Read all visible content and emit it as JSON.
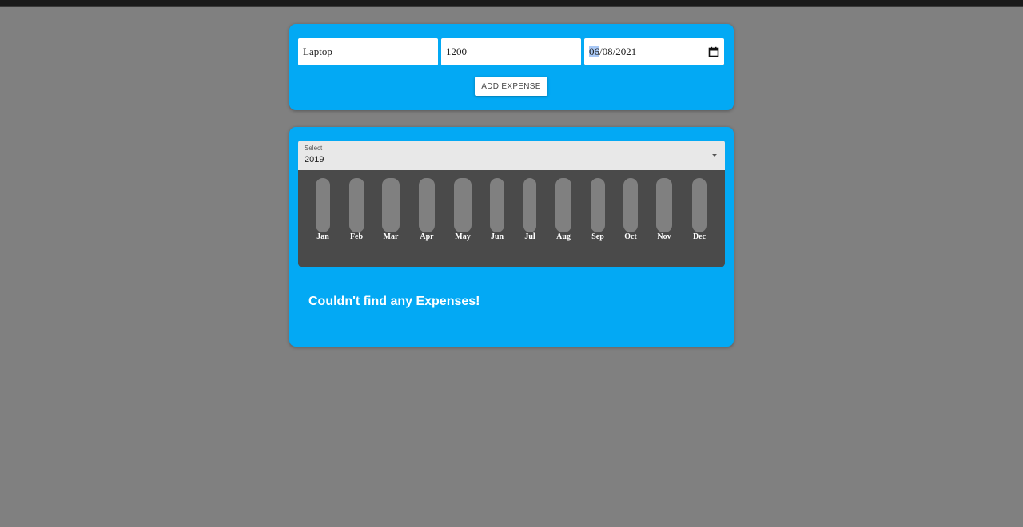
{
  "form": {
    "title_value": "Laptop",
    "amount_value": "1200",
    "date": {
      "highlighted": "06",
      "rest": "/08/2021"
    },
    "add_button_label": "ADD EXPENSE"
  },
  "filter": {
    "label": "Select",
    "value": "2019"
  },
  "chart_data": {
    "type": "bar",
    "categories": [
      "Jan",
      "Feb",
      "Mar",
      "Apr",
      "May",
      "Jun",
      "Jul",
      "Aug",
      "Sep",
      "Oct",
      "Nov",
      "Dec"
    ],
    "values": [
      0,
      0,
      0,
      0,
      0,
      0,
      0,
      0,
      0,
      0,
      0,
      0
    ],
    "title": "",
    "xlabel": "",
    "ylabel": ""
  },
  "expenses": {
    "empty_message": "Couldn't find any Expenses!"
  },
  "colors": {
    "page_background": "#808080",
    "card_background": "#03a9f4",
    "chart_background": "#4a4a4a",
    "bar_track": "#808080",
    "bar_fill": "#4826b9"
  },
  "icons": {
    "date_picker": "calendar-icon",
    "select_dropdown": "caret-down-icon"
  }
}
